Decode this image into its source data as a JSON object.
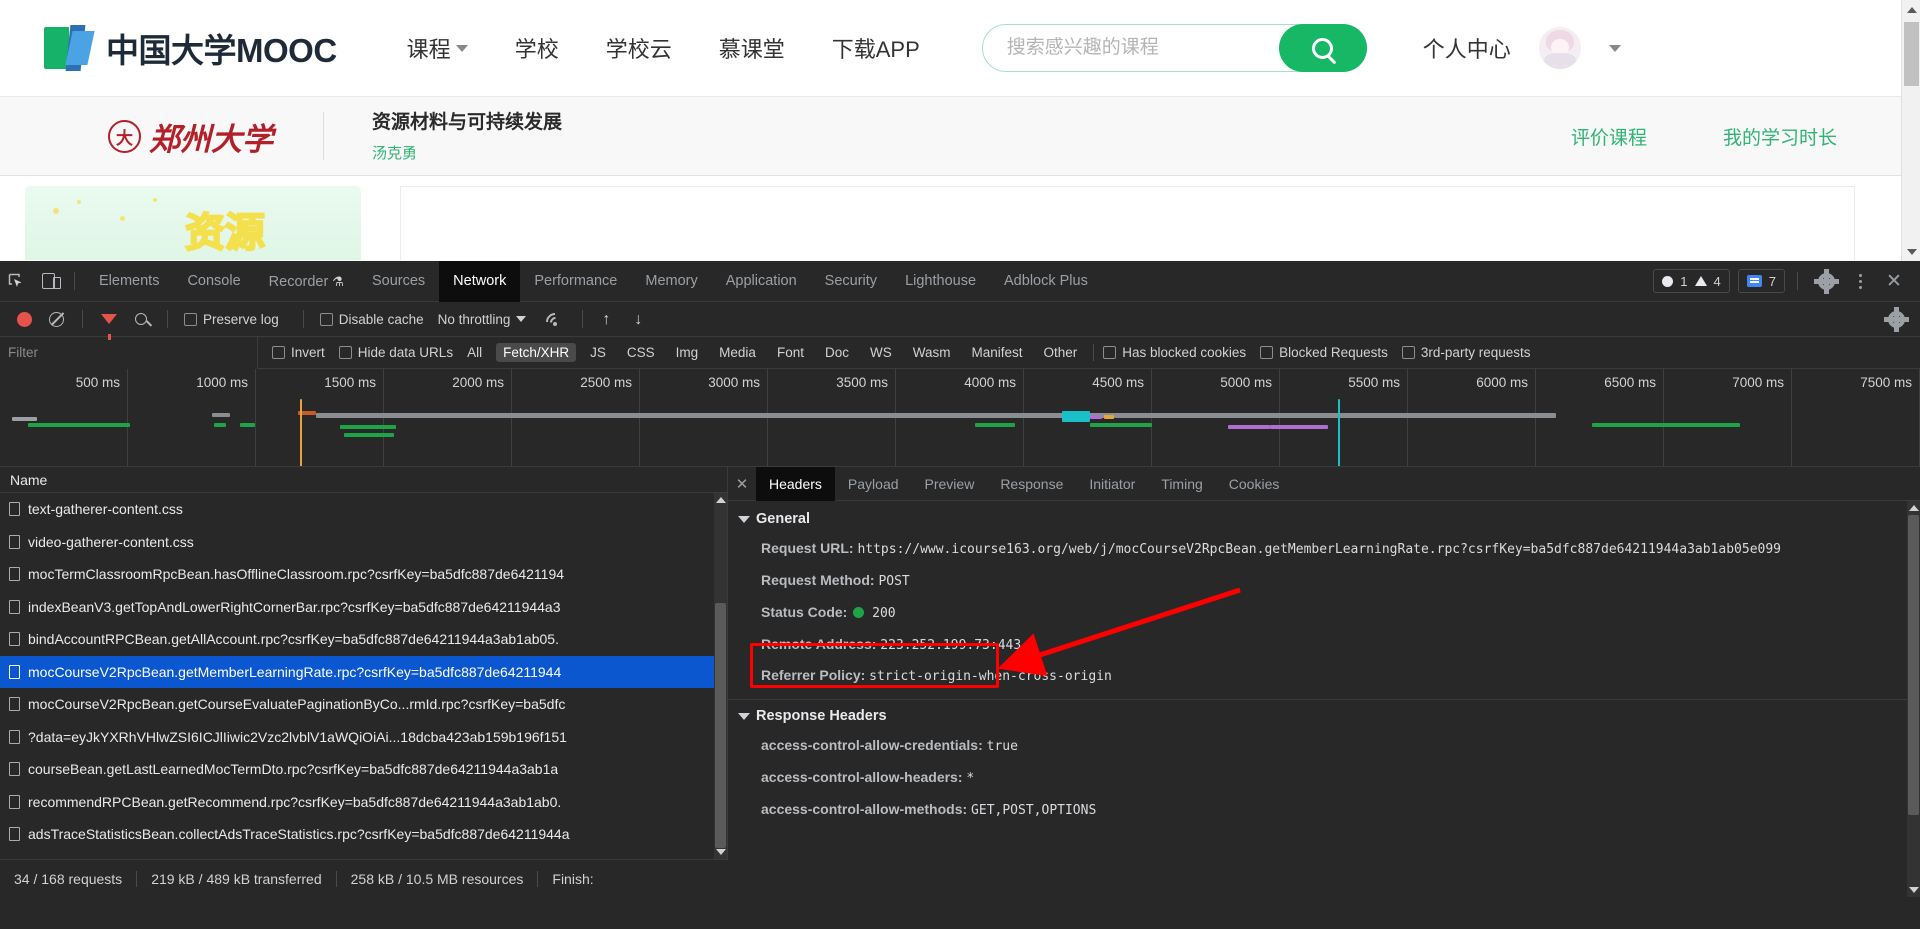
{
  "site": {
    "logo_text": "中国大学MOOC",
    "nav": [
      {
        "label": "课程",
        "has_caret": true
      },
      {
        "label": "学校",
        "has_caret": false
      },
      {
        "label": "学校云",
        "has_caret": false
      },
      {
        "label": "慕课堂",
        "has_caret": false
      },
      {
        "label": "下载APP",
        "has_caret": false
      }
    ],
    "search": {
      "placeholder": "搜索感兴趣的课程",
      "value": "",
      "icon": "search-icon"
    },
    "user_center": "个人中心"
  },
  "course": {
    "university": "郑州大学",
    "title": "资源材料与可持续发展",
    "teacher": "汤克勇",
    "links": [
      "评价课程",
      "我的学习时长"
    ],
    "banner_text": "资源"
  },
  "devtools": {
    "tabs": [
      {
        "label": "Elements",
        "active": false
      },
      {
        "label": "Console",
        "active": false
      },
      {
        "label": "Recorder",
        "active": false,
        "suffix": "⚗"
      },
      {
        "label": "Sources",
        "active": false
      },
      {
        "label": "Network",
        "active": true
      },
      {
        "label": "Performance",
        "active": false
      },
      {
        "label": "Memory",
        "active": false
      },
      {
        "label": "Application",
        "active": false
      },
      {
        "label": "Security",
        "active": false
      },
      {
        "label": "Lighthouse",
        "active": false
      },
      {
        "label": "Adblock Plus",
        "active": false
      }
    ],
    "badges": {
      "errors": "1",
      "warnings": "4",
      "messages": "7"
    },
    "toolbar": {
      "record_title": "record-button",
      "clear_title": "clear-button",
      "preserve_log": "Preserve log",
      "disable_cache": "Disable cache",
      "throttling": "No throttling"
    },
    "filter": {
      "placeholder": "Filter",
      "value": "",
      "invert": "Invert",
      "hide_data_urls": "Hide data URLs",
      "types": [
        "All",
        "Fetch/XHR",
        "JS",
        "CSS",
        "Img",
        "Media",
        "Font",
        "Doc",
        "WS",
        "Wasm",
        "Manifest",
        "Other"
      ],
      "selected_type": "Fetch/XHR",
      "has_blocked_cookies": "Has blocked cookies",
      "blocked_requests": "Blocked Requests",
      "third_party": "3rd-party requests"
    },
    "timeline": {
      "ticks": [
        "500 ms",
        "1000 ms",
        "1500 ms",
        "2000 ms",
        "2500 ms",
        "3000 ms",
        "3500 ms",
        "4000 ms",
        "4500 ms",
        "5000 ms",
        "5500 ms",
        "6000 ms",
        "6500 ms",
        "7000 ms",
        "7500 ms"
      ]
    },
    "requests": {
      "column_header": "Name",
      "rows": [
        {
          "name": "text-gatherer-content.css",
          "selected": false
        },
        {
          "name": "video-gatherer-content.css",
          "selected": false
        },
        {
          "name": "mocTermClassroomRpcBean.hasOfflineClassroom.rpc?csrfKey=ba5dfc887de6421194",
          "selected": false
        },
        {
          "name": "indexBeanV3.getTopAndLowerRightCornerBar.rpc?csrfKey=ba5dfc887de64211944a3",
          "selected": false
        },
        {
          "name": "bindAccountRPCBean.getAllAccount.rpc?csrfKey=ba5dfc887de64211944a3ab1ab05.",
          "selected": false
        },
        {
          "name": "mocCourseV2RpcBean.getMemberLearningRate.rpc?csrfKey=ba5dfc887de64211944",
          "selected": true
        },
        {
          "name": "mocCourseV2RpcBean.getCourseEvaluatePaginationByCo...rmId.rpc?csrfKey=ba5dfc",
          "selected": false
        },
        {
          "name": "?data=eyJkYXRhVHlwZSI6ICJlIiwic2Vzc2lvblV1aWQiOiAi...18dcba423ab159b196f151",
          "selected": false
        },
        {
          "name": "courseBean.getLastLearnedMocTermDto.rpc?csrfKey=ba5dfc887de64211944a3ab1a",
          "selected": false
        },
        {
          "name": "recommendRPCBean.getRecommend.rpc?csrfKey=ba5dfc887de64211944a3ab1ab0.",
          "selected": false
        },
        {
          "name": "adsTraceStatisticsBean.collectAdsTraceStatistics.rpc?csrfKey=ba5dfc887de64211944a",
          "selected": false
        }
      ]
    },
    "status_bar": {
      "requests": "34 / 168 requests",
      "transferred": "219 kB / 489 kB transferred",
      "resources": "258 kB / 10.5 MB resources",
      "finish": "Finish:"
    },
    "detail": {
      "tabs": [
        {
          "label": "Headers",
          "active": true
        },
        {
          "label": "Payload",
          "active": false
        },
        {
          "label": "Preview",
          "active": false
        },
        {
          "label": "Response",
          "active": false
        },
        {
          "label": "Initiator",
          "active": false
        },
        {
          "label": "Timing",
          "active": false
        },
        {
          "label": "Cookies",
          "active": false
        }
      ],
      "general_section": "General",
      "general": [
        {
          "key": "Request URL:",
          "value": "https://www.icourse163.org/web/j/mocCourseV2RpcBean.getMemberLearningRate.rpc?csrfKey=ba5dfc887de64211944a3ab1ab05e099"
        },
        {
          "key": "Request Method:",
          "value": "POST"
        },
        {
          "key": "Status Code:",
          "value": "200",
          "has_status_dot": true
        },
        {
          "key": "Remote Address:",
          "value": "223.252.199.73:443"
        },
        {
          "key": "Referrer Policy:",
          "value": "strict-origin-when-cross-origin"
        }
      ],
      "response_section": "Response Headers",
      "response_headers": [
        {
          "key": "access-control-allow-credentials:",
          "value": "true"
        },
        {
          "key": "access-control-allow-headers:",
          "value": "*"
        },
        {
          "key": "access-control-allow-methods:",
          "value": "GET,POST,OPTIONS"
        }
      ]
    }
  },
  "annotation": {
    "highlight_color": "#ff0000",
    "highlight_target": "Request Method: POST"
  }
}
